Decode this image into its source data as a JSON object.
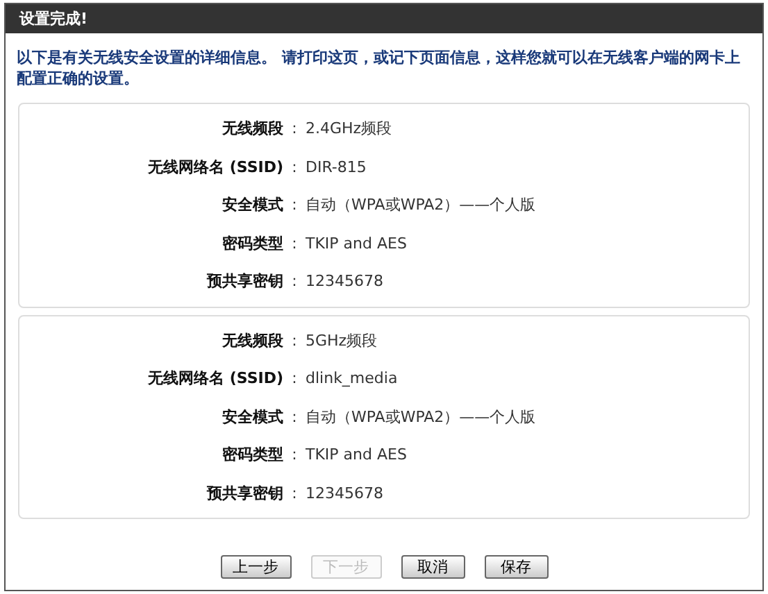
{
  "header": {
    "title": "设置完成!"
  },
  "intro": "以下是有关无线安全设置的详细信息。 请打印这页，或记下页面信息，这样您就可以在无线客户端的网卡上配置正确的设置。",
  "panels": [
    {
      "rows": [
        {
          "label": "无线频段",
          "separator": ":",
          "value": "2.4GHz频段"
        },
        {
          "label": "无线网络名 (SSID)",
          "separator": ":",
          "value": "DIR-815"
        },
        {
          "label": "安全模式",
          "separator": ":",
          "value": "自动（WPA或WPA2）——个人版"
        },
        {
          "label": "密码类型",
          "separator": ":",
          "value": "TKIP and AES"
        },
        {
          "label": "预共享密钥",
          "separator": ":",
          "value": "12345678"
        }
      ]
    },
    {
      "rows": [
        {
          "label": "无线频段",
          "separator": ":",
          "value": "5GHz频段"
        },
        {
          "label": "无线网络名 (SSID)",
          "separator": ":",
          "value": "dlink_media"
        },
        {
          "label": "安全模式",
          "separator": ":",
          "value": "自动（WPA或WPA2）——个人版"
        },
        {
          "label": "密码类型",
          "separator": ":",
          "value": "TKIP and AES"
        },
        {
          "label": "预共享密钥",
          "separator": ":",
          "value": "12345678"
        }
      ]
    }
  ],
  "buttons": [
    {
      "label": "上一步",
      "disabled": false
    },
    {
      "label": "下一步",
      "disabled": true
    },
    {
      "label": "取消",
      "disabled": false
    },
    {
      "label": "保存",
      "disabled": false
    }
  ]
}
